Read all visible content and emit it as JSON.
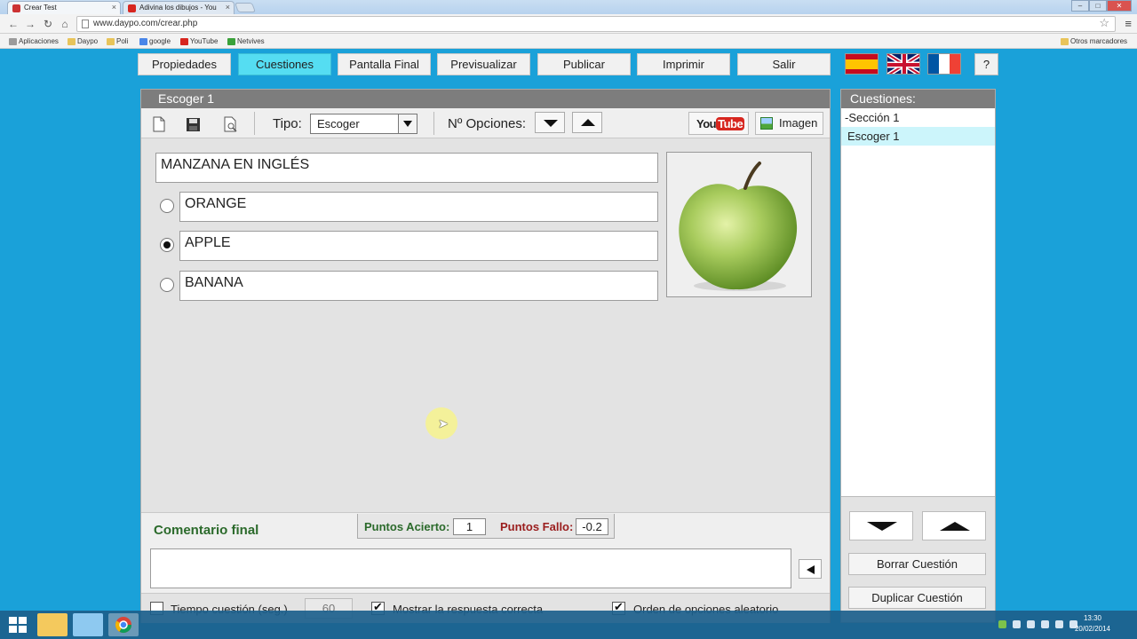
{
  "browser": {
    "tabs": [
      {
        "label": "Crear Test"
      },
      {
        "label": "Adivina los dibujos - You"
      }
    ],
    "url": "www.daypo.com/crear.php",
    "bookmarks": [
      "Aplicaciones",
      "Daypo",
      "Poli",
      "google",
      "YouTube",
      "Netvives"
    ],
    "other_bookmarks": "Otros marcadores"
  },
  "nav": {
    "tabs": [
      "Propiedades",
      "Cuestiones",
      "Pantalla Final",
      "Previsualizar",
      "Publicar",
      "Imprimir",
      "Salir"
    ],
    "active": "Cuestiones",
    "help_label": "?"
  },
  "editor": {
    "header": "Escoger 1",
    "tipo_label": "Tipo:",
    "tipo_value": "Escoger",
    "opciones_label": "Nº Opciones:",
    "youtube_label": "You",
    "youtube_tube": "Tube",
    "image_label": "Imagen",
    "question": "MANZANA EN INGLÉS",
    "options": [
      {
        "text": "ORANGE",
        "selected": false
      },
      {
        "text": "APPLE",
        "selected": true
      },
      {
        "text": "BANANA",
        "selected": false
      }
    ],
    "comentario_label": "Comentario final",
    "puntos_acierto_label": "Puntos Acierto:",
    "puntos_acierto_value": "1",
    "puntos_fallo_label": "Puntos Fallo:",
    "puntos_fallo_value": "-0.2",
    "tiempo_label": "Tiempo cuestión (seg.)",
    "tiempo_value": "60",
    "mostrar_label": "Mostrar la respuesta correcta",
    "orden_label": "Orden de opciones aleatorio"
  },
  "cuestiones": {
    "header": "Cuestiones:",
    "items": [
      "-Sección 1",
      "Escoger 1"
    ],
    "borrar_label": "Borrar Cuestión",
    "duplicar_label": "Duplicar Cuestión"
  },
  "taskbar": {
    "time": "13:30",
    "date": "20/02/2014"
  },
  "colors": {
    "background": "#1aa1d9",
    "active_tab": "#55ddf2",
    "selected_item": "#ccf5fb",
    "header_gray": "#7d7d7d",
    "green_label": "#2b6a2b",
    "red_label": "#9a1d1d"
  }
}
